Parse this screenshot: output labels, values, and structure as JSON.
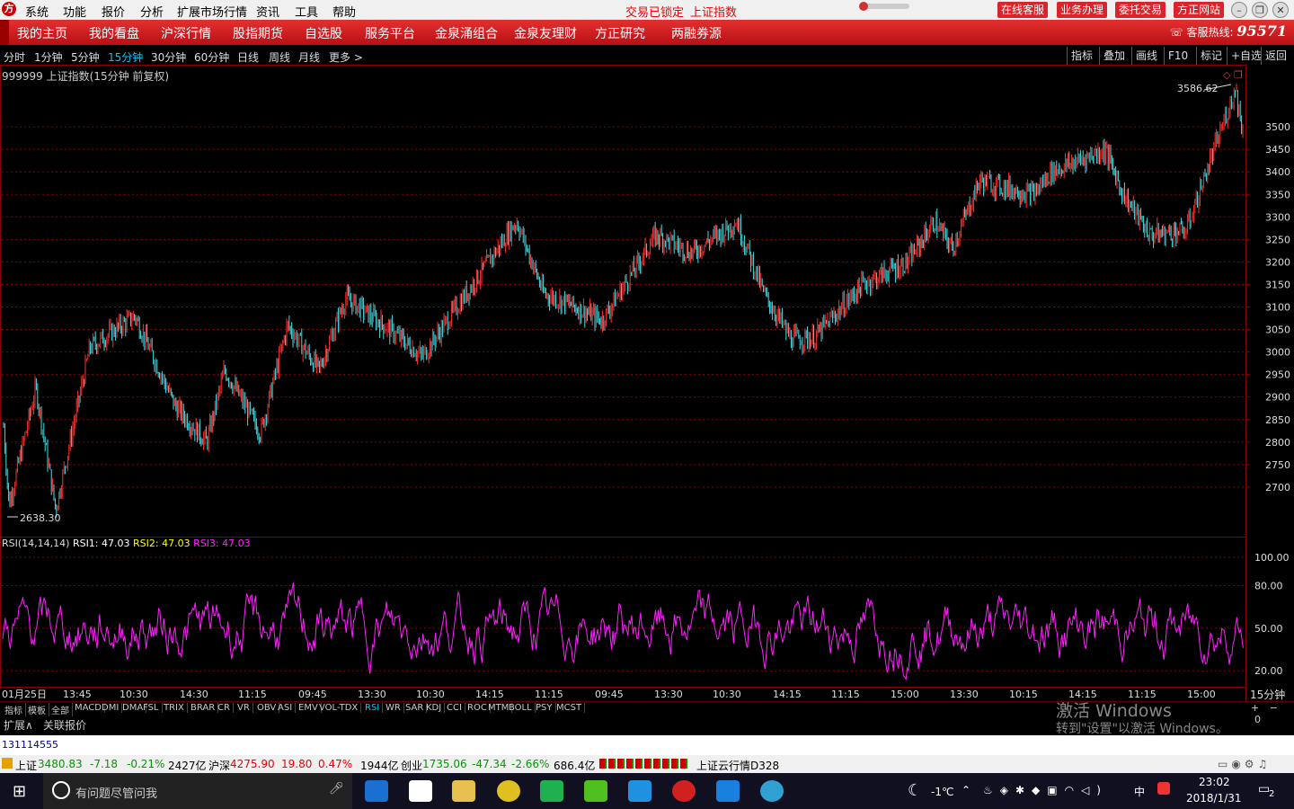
{
  "menubar": {
    "items": [
      "系统",
      "功能",
      "报价",
      "分析",
      "扩展市场行情",
      "资讯",
      "工具",
      "帮助"
    ],
    "status_lock": "交易已锁定",
    "status_index": "上证指数",
    "right_buttons": [
      "在线客服",
      "业务办理",
      "委托交易",
      "方正网站"
    ]
  },
  "nav": {
    "items": [
      "我的主页",
      "我的看盘",
      "沪深行情",
      "股指期货",
      "自选股",
      "服务平台",
      "金泉涌组合",
      "金泉友理财",
      "方正研究",
      "两融券源"
    ],
    "hotline_label": "客服热线:",
    "hotline_number": "95571"
  },
  "periods": {
    "items": [
      "分时",
      "1分钟",
      "5分钟",
      "15分钟",
      "30分钟",
      "60分钟",
      "日线",
      "周线",
      "月线",
      "更多 >"
    ],
    "active": "15分钟",
    "right_buttons": [
      "指标",
      "叠加",
      "画线",
      "F10",
      "标记",
      "+自选",
      "返回"
    ]
  },
  "chart": {
    "title": "999999 上证指数(15分钟 前复权)",
    "high_label": "3586.62",
    "low_label": "2638.30",
    "colors": {
      "up": "#ff3030",
      "down": "#40e0e8",
      "rsi": "#ff20ff",
      "grid": "#8b0000"
    }
  },
  "chart_data": [
    {
      "type": "candlestick",
      "title": "999999 上证指数(15分钟 前复权)",
      "ylim": [
        2600,
        3610
      ],
      "yticks": [
        2700,
        2750,
        2800,
        2850,
        2900,
        2950,
        3000,
        3050,
        3100,
        3150,
        3200,
        3250,
        3300,
        3350,
        3400,
        3450,
        3500
      ],
      "xticks": [
        "01月25日",
        "13:45",
        "10:30",
        "14:30",
        "11:15",
        "09:45",
        "13:30",
        "10:30",
        "14:15",
        "11:15",
        "09:45",
        "13:30",
        "10:30",
        "14:15",
        "11:15",
        "15:00",
        "13:30",
        "10:15",
        "14:15",
        "11:15",
        "15:00"
      ],
      "high": 3586.62,
      "low": 2638.3,
      "trend": [
        [
          0,
          2950
        ],
        [
          10,
          2660
        ],
        [
          40,
          2920
        ],
        [
          62,
          2650
        ],
        [
          100,
          3010
        ],
        [
          150,
          3080
        ],
        [
          195,
          2880
        ],
        [
          230,
          2800
        ],
        [
          250,
          2960
        ],
        [
          290,
          2820
        ],
        [
          320,
          3060
        ],
        [
          355,
          2960
        ],
        [
          385,
          3120
        ],
        [
          440,
          3040
        ],
        [
          470,
          2990
        ],
        [
          540,
          3190
        ],
        [
          575,
          3290
        ],
        [
          605,
          3130
        ],
        [
          640,
          3100
        ],
        [
          670,
          3070
        ],
        [
          730,
          3260
        ],
        [
          770,
          3220
        ],
        [
          820,
          3290
        ],
        [
          850,
          3130
        ],
        [
          880,
          3030
        ],
        [
          905,
          3030
        ],
        [
          960,
          3150
        ],
        [
          1010,
          3200
        ],
        [
          1040,
          3290
        ],
        [
          1060,
          3230
        ],
        [
          1090,
          3380
        ],
        [
          1150,
          3350
        ],
        [
          1170,
          3400
        ],
        [
          1230,
          3450
        ],
        [
          1250,
          3350
        ],
        [
          1280,
          3260
        ],
        [
          1320,
          3270
        ],
        [
          1375,
          3586
        ],
        [
          1385,
          3460
        ]
      ]
    },
    {
      "type": "line",
      "title": "RSI(14,14,14)",
      "series": [
        {
          "name": "RSI1",
          "value": 47.03
        },
        {
          "name": "RSI2",
          "value": 47.03
        },
        {
          "name": "RSI3",
          "value": 47.03
        }
      ],
      "ylim": [
        10,
        105
      ],
      "yticks": [
        20.0,
        50.0,
        80.0,
        100.0
      ]
    }
  ],
  "rsi": {
    "label": "RSI(14,14,14)",
    "rsi1": "RSI1: 47.03",
    "rsi2": "RSI2: 47.03",
    "rsi3": "RSI3: 47.03"
  },
  "xaxis_right": "15分钟",
  "indicator_tabs": [
    "指标",
    "模板",
    "全部",
    "MACD",
    "DMI",
    "DMA",
    "FSL",
    "TRIX",
    "BRAR",
    "CR",
    "VR",
    "OBV",
    "ASI",
    "EMV",
    "VOL-TDX",
    "RSI",
    "WR",
    "SAR",
    "KDJ",
    "CCI",
    "ROC",
    "MTM",
    "BOLL",
    "PSY",
    "MCST"
  ],
  "indicator_active": "RSI",
  "sub_tabs": [
    "扩展∧",
    "关联报价"
  ],
  "watermark": {
    "line1": "激活 Windows",
    "line2": "转到\"设置\"以激活 Windows。"
  },
  "info_code": "131114555",
  "status": {
    "sh_label": "上证",
    "sh_value": "3480.83",
    "sh_change": "-7.18",
    "sh_pct": "-0.21%",
    "sh_amount": "2427亿",
    "hs_label": "沪深",
    "hs_value": "4275.90",
    "hs_change": "19.80",
    "hs_pct": "0.47%",
    "hs_amount": "1944亿",
    "cy_label": "创业",
    "cy_value": "1735.06",
    "cy_change": "-47.34",
    "cy_pct": "-2.66%",
    "cy_amount": "686.4亿",
    "cloud": "上证云行情D328"
  },
  "taskbar": {
    "search_placeholder": "有问题尽管问我",
    "weather": "-1℃",
    "ime": "中",
    "time": "23:02",
    "date": "2018/1/31",
    "notifications": "2"
  }
}
